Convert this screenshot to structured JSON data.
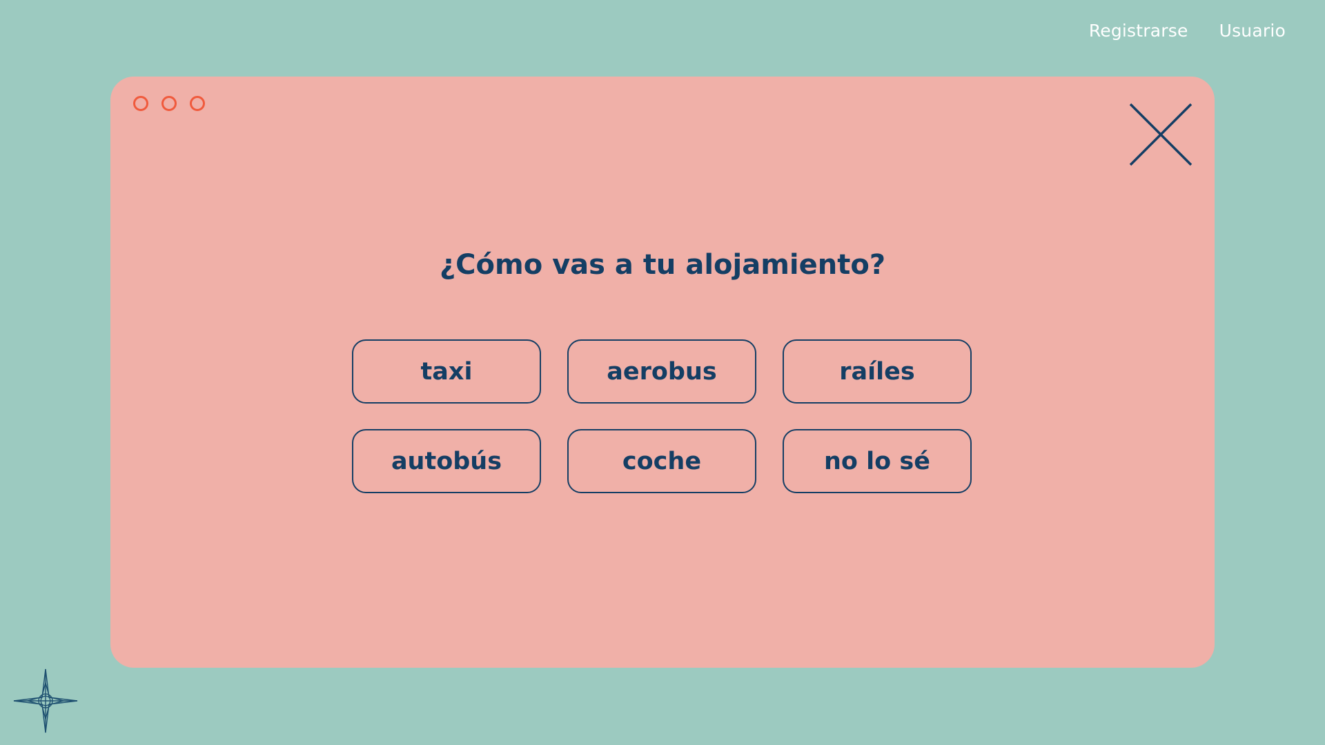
{
  "nav": {
    "signup_label": "Registrarse",
    "user_label": "Usuario"
  },
  "dialog": {
    "question": "¿Cómo vas a tu alojamiento?",
    "options": [
      "taxi",
      "aerobus",
      "raíles",
      "autobús",
      "coche",
      "no lo sé"
    ]
  },
  "icons": {
    "close": "close-icon",
    "dots": "window-dots-icon",
    "compass": "compass-star-icon"
  },
  "colors": {
    "background": "#9ccac0",
    "window": "#f0b0a8",
    "text": "#143e64",
    "dots": "#f05a3c",
    "nav_text": "#ffffff"
  }
}
